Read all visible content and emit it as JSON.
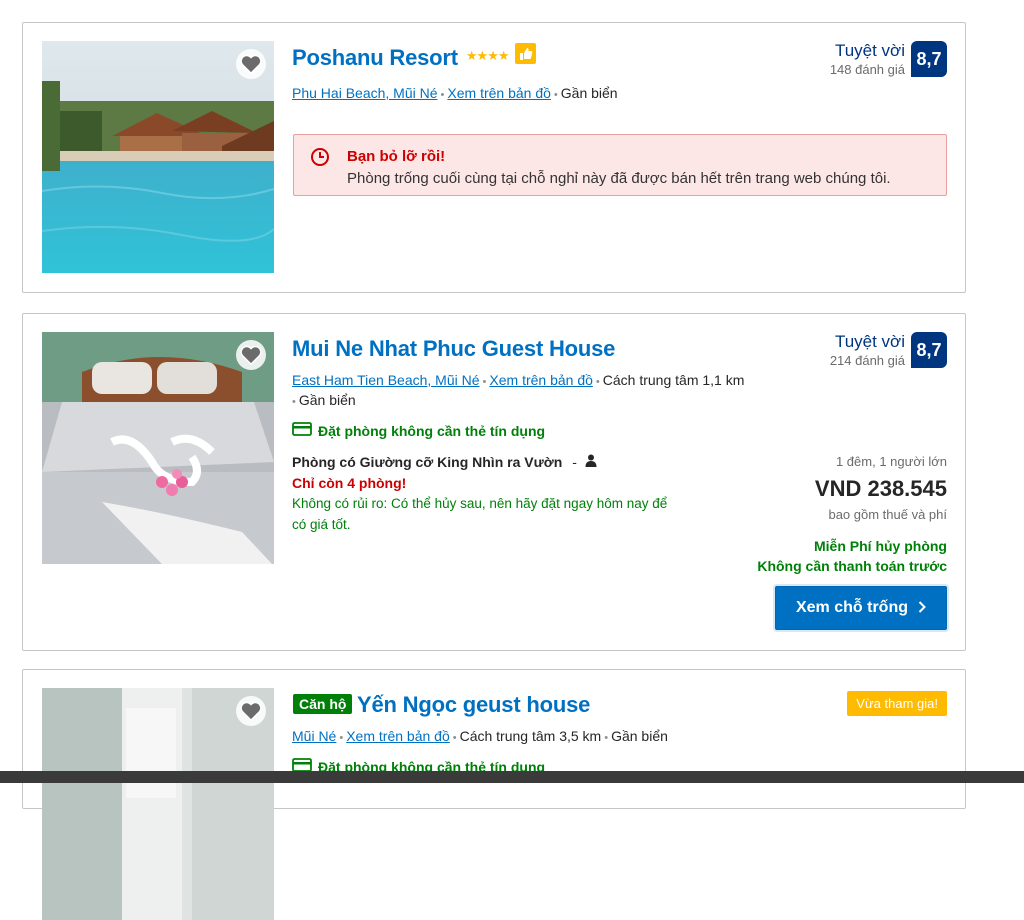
{
  "cards": [
    {
      "name": "Poshanu Resort",
      "stars": "★★★★",
      "location": "Phu Hai Beach, Mũi Né",
      "map_link": "Xem trên bản đồ",
      "extra": "Gần biển",
      "review_word": "Tuyệt vời",
      "review_count": "148 đánh giá",
      "score": "8,7",
      "alert_title": "Bạn bỏ lỡ rồi!",
      "alert_text": "Phòng trống cuối cùng tại chỗ nghỉ này đã được bán hết trên trang web chúng tôi."
    },
    {
      "name": "Mui Ne Nhat Phuc Guest House",
      "location": "East Ham Tien Beach, Mũi Né",
      "map_link": "Xem trên bản đồ",
      "distance": "Cách trung tâm 1,1 km",
      "extra": "Gần biển",
      "review_word": "Tuyệt vời",
      "review_count": "214 đánh giá",
      "score": "8,7",
      "no_card": "Đặt phòng không cần thẻ tín dụng",
      "room": "Phòng có Giường cỡ King Nhìn ra Vườn",
      "room_sep": "-",
      "scarcity": "Chỉ còn 4 phòng!",
      "no_risk": "Không có rủi ro: Có thể hủy sau, nên hãy đặt ngay hôm nay để có giá tốt.",
      "nights": "1 đêm, 1 người lớn",
      "price": "VND 238.545",
      "tax": "bao gồm thuế và phí",
      "free_cancel": "Miễn Phí hủy phòng",
      "no_prepay": "Không cần thanh toán trước",
      "cta": "Xem chỗ trống"
    },
    {
      "type_badge": "Căn hộ",
      "name": "Yến Ngọc geust house",
      "location": "Mũi Né",
      "map_link": "Xem trên bản đồ",
      "distance": "Cách trung tâm 3,5 km",
      "extra": "Gần biển",
      "new_badge": "Vừa tham gia!",
      "no_card": "Đặt phòng không cần thẻ tín dụng"
    }
  ],
  "colors": {
    "link_blue": "#0071c2",
    "score_blue": "#003580",
    "green": "#008009",
    "red": "#cc0000",
    "yellow": "#febb02"
  },
  "icons": [
    "heart-icon",
    "thumbs-up-icon",
    "clock-icon",
    "credit-card-icon",
    "person-icon",
    "chevron-right-icon"
  ]
}
